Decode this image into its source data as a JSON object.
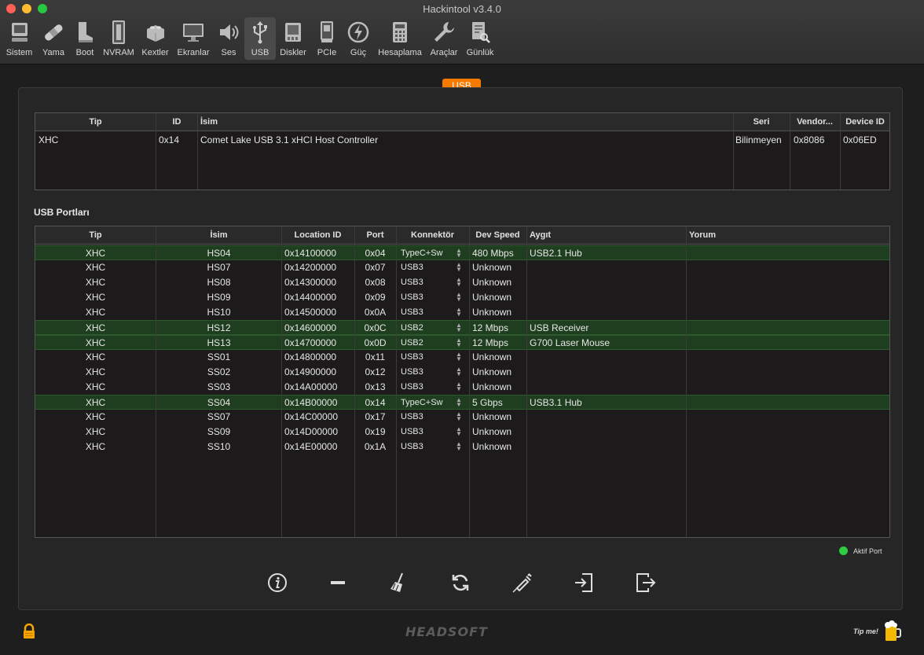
{
  "window": {
    "title": "Hackintool v3.4.0"
  },
  "toolbar": {
    "items": [
      {
        "label": "Sistem",
        "icon": "computer-icon"
      },
      {
        "label": "Yama",
        "icon": "bandage-icon"
      },
      {
        "label": "Boot",
        "icon": "boot-icon"
      },
      {
        "label": "NVRAM",
        "icon": "memory-chip-icon"
      },
      {
        "label": "Kextler",
        "icon": "lego-brick-icon"
      },
      {
        "label": "Ekranlar",
        "icon": "monitor-icon"
      },
      {
        "label": "Ses",
        "icon": "speaker-icon"
      },
      {
        "label": "USB",
        "icon": "usb-icon",
        "active": true
      },
      {
        "label": "Diskler",
        "icon": "disk-icon"
      },
      {
        "label": "PCIe",
        "icon": "pcie-card-icon"
      },
      {
        "label": "Güç",
        "icon": "power-bolt-icon"
      },
      {
        "label": "Hesaplama",
        "icon": "calculator-icon"
      },
      {
        "label": "Araçlar",
        "icon": "wrench-icon"
      },
      {
        "label": "Günlük",
        "icon": "log-search-icon"
      }
    ]
  },
  "tab": {
    "label": "USB"
  },
  "controllers": {
    "headers": {
      "tip": "Tip",
      "id": "ID",
      "isim": "İsim",
      "seri": "Seri",
      "vendor": "Vendor...",
      "device": "Device ID"
    },
    "rows": [
      {
        "tip": "XHC",
        "id": "0x14",
        "isim": "Comet Lake USB 3.1 xHCI Host Controller",
        "seri": "Bilinmeyen",
        "vendor": "0x8086",
        "device": "0x06ED"
      }
    ]
  },
  "ports": {
    "title": "USB Portları",
    "headers": {
      "tip": "Tip",
      "isim": "İsim",
      "location": "Location ID",
      "port": "Port",
      "connector": "Konnektör",
      "speed": "Dev Speed",
      "device": "Aygıt",
      "comment": "Yorum"
    },
    "rows": [
      {
        "tip": "XHC",
        "isim": "HS04",
        "location": "0x14100000",
        "port": "0x04",
        "connector": "TypeC+Sw",
        "speed": "480 Mbps",
        "device": "USB2.1 Hub",
        "active": true
      },
      {
        "tip": "XHC",
        "isim": "HS07",
        "location": "0x14200000",
        "port": "0x07",
        "connector": "USB3",
        "speed": "Unknown",
        "device": "",
        "active": false
      },
      {
        "tip": "XHC",
        "isim": "HS08",
        "location": "0x14300000",
        "port": "0x08",
        "connector": "USB3",
        "speed": "Unknown",
        "device": "",
        "active": false
      },
      {
        "tip": "XHC",
        "isim": "HS09",
        "location": "0x14400000",
        "port": "0x09",
        "connector": "USB3",
        "speed": "Unknown",
        "device": "",
        "active": false
      },
      {
        "tip": "XHC",
        "isim": "HS10",
        "location": "0x14500000",
        "port": "0x0A",
        "connector": "USB3",
        "speed": "Unknown",
        "device": "",
        "active": false
      },
      {
        "tip": "XHC",
        "isim": "HS12",
        "location": "0x14600000",
        "port": "0x0C",
        "connector": "USB2",
        "speed": "12 Mbps",
        "device": "USB Receiver",
        "active": true
      },
      {
        "tip": "XHC",
        "isim": "HS13",
        "location": "0x14700000",
        "port": "0x0D",
        "connector": "USB2",
        "speed": "12 Mbps",
        "device": "G700 Laser Mouse",
        "active": true
      },
      {
        "tip": "XHC",
        "isim": "SS01",
        "location": "0x14800000",
        "port": "0x11",
        "connector": "USB3",
        "speed": "Unknown",
        "device": "",
        "active": false
      },
      {
        "tip": "XHC",
        "isim": "SS02",
        "location": "0x14900000",
        "port": "0x12",
        "connector": "USB3",
        "speed": "Unknown",
        "device": "",
        "active": false
      },
      {
        "tip": "XHC",
        "isim": "SS03",
        "location": "0x14A00000",
        "port": "0x13",
        "connector": "USB3",
        "speed": "Unknown",
        "device": "",
        "active": false
      },
      {
        "tip": "XHC",
        "isim": "SS04",
        "location": "0x14B00000",
        "port": "0x14",
        "connector": "TypeC+Sw",
        "speed": "5 Gbps",
        "device": "USB3.1 Hub",
        "active": true
      },
      {
        "tip": "XHC",
        "isim": "SS07",
        "location": "0x14C00000",
        "port": "0x17",
        "connector": "USB3",
        "speed": "Unknown",
        "device": "",
        "active": false
      },
      {
        "tip": "XHC",
        "isim": "SS09",
        "location": "0x14D00000",
        "port": "0x19",
        "connector": "USB3",
        "speed": "Unknown",
        "device": "",
        "active": false
      },
      {
        "tip": "XHC",
        "isim": "SS10",
        "location": "0x14E00000",
        "port": "0x1A",
        "connector": "USB3",
        "speed": "Unknown",
        "device": "",
        "active": false
      }
    ]
  },
  "legend": {
    "label": "Aktif Port",
    "color": "#2ecc40"
  },
  "actions": [
    {
      "name": "info-button",
      "icon": "info-icon"
    },
    {
      "name": "remove-button",
      "icon": "minus-icon"
    },
    {
      "name": "clear-button",
      "icon": "broom-icon"
    },
    {
      "name": "refresh-button",
      "icon": "refresh-icon"
    },
    {
      "name": "inject-button",
      "icon": "syringe-icon"
    },
    {
      "name": "import-button",
      "icon": "import-icon"
    },
    {
      "name": "export-button",
      "icon": "export-icon"
    }
  ],
  "footer": {
    "brand": "HEADSOFT",
    "tip": "Tip me!"
  },
  "colors": {
    "accent": "#f77a00",
    "active_row": "#1f3d1f",
    "active_dot": "#2ecc40"
  }
}
